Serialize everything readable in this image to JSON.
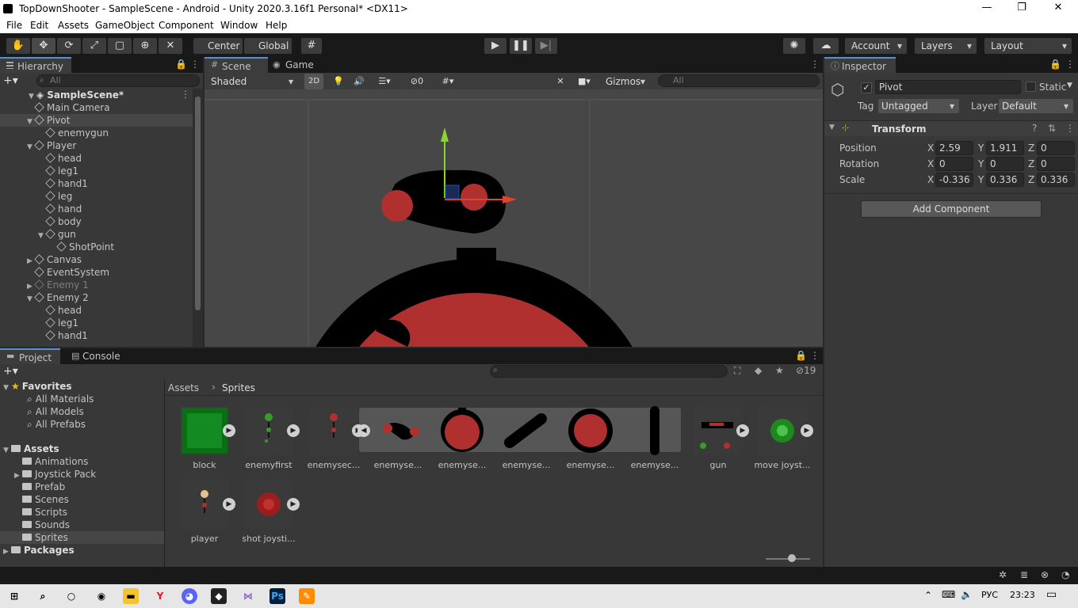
{
  "window": {
    "title": "TopDownShooter - SampleScene - Android - Unity 2020.3.16f1 Personal* <DX11>",
    "minimize": "—",
    "maximize": "❐",
    "close": "✕"
  },
  "menu": [
    "File",
    "Edit",
    "Assets",
    "GameObject",
    "Component",
    "Window",
    "Help"
  ],
  "toolbar": {
    "center": "Center",
    "global": "Global",
    "account": "Account",
    "layers": "Layers",
    "layout": "Layout"
  },
  "hierarchy": {
    "tab": "Hierarchy",
    "search_placeholder": "All",
    "scene": "SampleScene*",
    "items": [
      {
        "label": "Main Camera",
        "indent": 1,
        "fold": ""
      },
      {
        "label": "Pivot",
        "indent": 1,
        "fold": "▼",
        "selected": true
      },
      {
        "label": "enemygun",
        "indent": 2,
        "fold": ""
      },
      {
        "label": "Player",
        "indent": 1,
        "fold": "▼"
      },
      {
        "label": "head",
        "indent": 2,
        "fold": ""
      },
      {
        "label": "leg1",
        "indent": 2,
        "fold": ""
      },
      {
        "label": "hand1",
        "indent": 2,
        "fold": ""
      },
      {
        "label": "leg",
        "indent": 2,
        "fold": ""
      },
      {
        "label": "hand",
        "indent": 2,
        "fold": ""
      },
      {
        "label": "body",
        "indent": 2,
        "fold": ""
      },
      {
        "label": "gun",
        "indent": 2,
        "fold": "▼"
      },
      {
        "label": "ShotPoint",
        "indent": 3,
        "fold": ""
      },
      {
        "label": "Canvas",
        "indent": 1,
        "fold": "▶"
      },
      {
        "label": "EventSystem",
        "indent": 1,
        "fold": ""
      },
      {
        "label": "Enemy 1",
        "indent": 1,
        "fold": "▶",
        "dim": true
      },
      {
        "label": "Enemy 2",
        "indent": 1,
        "fold": "▼"
      },
      {
        "label": "head",
        "indent": 2,
        "fold": ""
      },
      {
        "label": "leg1",
        "indent": 2,
        "fold": ""
      },
      {
        "label": "hand1",
        "indent": 2,
        "fold": ""
      }
    ]
  },
  "scene": {
    "tab_scene": "Scene",
    "tab_game": "Game",
    "shading": "Shaded",
    "mode2d": "2D",
    "hidden_count": "0",
    "gizmos": "Gizmos",
    "search_placeholder": "All"
  },
  "inspector": {
    "tab": "Inspector",
    "object_name": "Pivot",
    "static_label": "Static",
    "tag_label": "Tag",
    "tag_value": "Untagged",
    "layer_label": "Layer",
    "layer_value": "Default",
    "component": "Transform",
    "position": {
      "label": "Position",
      "x": "2.59",
      "y": "1.911",
      "z": "0"
    },
    "rotation": {
      "label": "Rotation",
      "x": "0",
      "y": "0",
      "z": "0"
    },
    "scale": {
      "label": "Scale",
      "x": "-0.336",
      "y": "0.336",
      "z": "0.336"
    },
    "add_component": "Add Component"
  },
  "project": {
    "tab_project": "Project",
    "tab_console": "Console",
    "hidden_count": "19",
    "breadcrumb_root": "Assets",
    "breadcrumb_current": "Sprites",
    "favorites": "Favorites",
    "favorites_items": [
      "All Materials",
      "All Models",
      "All Prefabs"
    ],
    "assets_root": "Assets",
    "asset_folders": [
      "Animations",
      "Joystick Pack",
      "Prefab",
      "Scenes",
      "Scripts",
      "Sounds",
      "Sprites"
    ],
    "packages": "Packages",
    "assets": [
      "block",
      "enemyfirst",
      "enemysec...",
      "enemyse...",
      "enemyse...",
      "enemyse...",
      "enemyse...",
      "enemyse...",
      "gun",
      "move joyst...",
      "player",
      "shot joysti..."
    ]
  },
  "taskbar": {
    "lang": "РУС",
    "time": "23:23"
  }
}
